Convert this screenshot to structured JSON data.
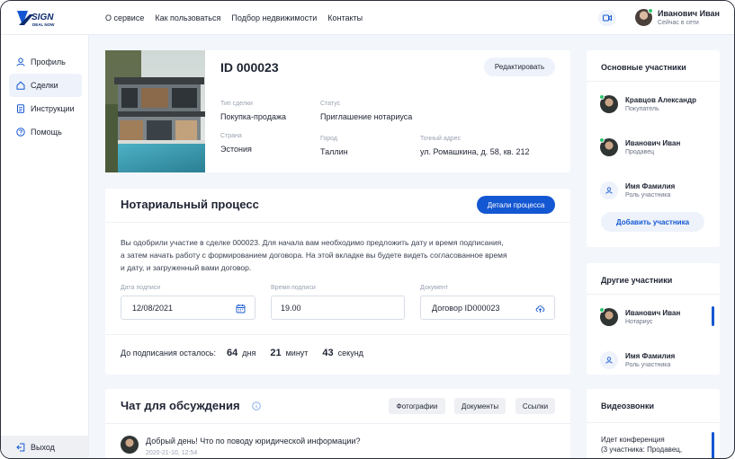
{
  "brand": {
    "logo_main": "SIGN",
    "logo_sub": "DEAL NOW"
  },
  "nav": [
    "О сервисе",
    "Как пользоваться",
    "Подбор недвижимости",
    "Контакты"
  ],
  "user": {
    "name": "Иванович Иван",
    "status": "Сейчас в сети"
  },
  "sidebar": {
    "items": [
      {
        "label": "Профиль",
        "icon": "user-icon"
      },
      {
        "label": "Сделки",
        "icon": "home-icon"
      },
      {
        "label": "Инструкции",
        "icon": "document-icon"
      },
      {
        "label": "Помощь",
        "icon": "help-icon"
      }
    ],
    "logout": "Выход"
  },
  "deal": {
    "id": "ID 000023",
    "edit_label": "Редактировать",
    "type_label": "Тип сделки",
    "type_value": "Покупка-продажа",
    "status_label": "Статус",
    "status_value": "Приглашение нотариуса",
    "country_label": "Страна",
    "country_value": "Эстония",
    "city_label": "Город",
    "city_value": "Таллин",
    "address_label": "Точный адрес",
    "address_value": "ул. Ромашкина, д. 58, кв. 212"
  },
  "notary": {
    "title": "Нотариальный процесс",
    "details_label": "Детали процесса",
    "text_lines": [
      "Вы одобрили участие в сделке 000023. Для начала вам необходимо предложить дату и время подписания,",
      "а затем начать работу с формированием договора. На этой вкладке вы будете видеть согласованное время",
      "и дату, и загруженный вами договор."
    ],
    "date_label": "Дата подписи",
    "date_value": "12/08/2021",
    "time_label": "Время подписи",
    "time_value": "19.00",
    "doc_label": "Документ",
    "doc_value": "Договор ID000023",
    "countdown_label": "До подписания осталось:",
    "days_value": "64",
    "days_unit": "дня",
    "minutes_value": "21",
    "minutes_unit": "минут",
    "seconds_value": "43",
    "seconds_unit": "секунд"
  },
  "chat": {
    "title": "Чат для обсуждения",
    "tabs": [
      "Фотографии",
      "Документы",
      "Ссылки"
    ],
    "message": "Добрый день! Что по поводу юридической информации?",
    "timestamp": "2020-21-10, 12:54"
  },
  "main_participants": {
    "title": "Основные участники",
    "items": [
      {
        "name": "Кравцов Александр",
        "role": "Покупатель"
      },
      {
        "name": "Иванович Иван",
        "role": "Продавец"
      },
      {
        "name": "Имя Фамилия",
        "role": "Роль участника"
      }
    ],
    "add_label": "Добавить участника"
  },
  "other_participants": {
    "title": "Другие участники",
    "items": [
      {
        "name": "Иванович Иван",
        "role": "Нотариус"
      },
      {
        "name": "Имя Фамилия",
        "role": "Роль участника"
      }
    ]
  },
  "video": {
    "title": "Видеозвонки",
    "line1": "Идет конференция",
    "line2": "(3 участника: Продавец,"
  },
  "colors": {
    "accent": "#1457d2",
    "online": "#2fc470",
    "background": "#f3f6fb"
  }
}
